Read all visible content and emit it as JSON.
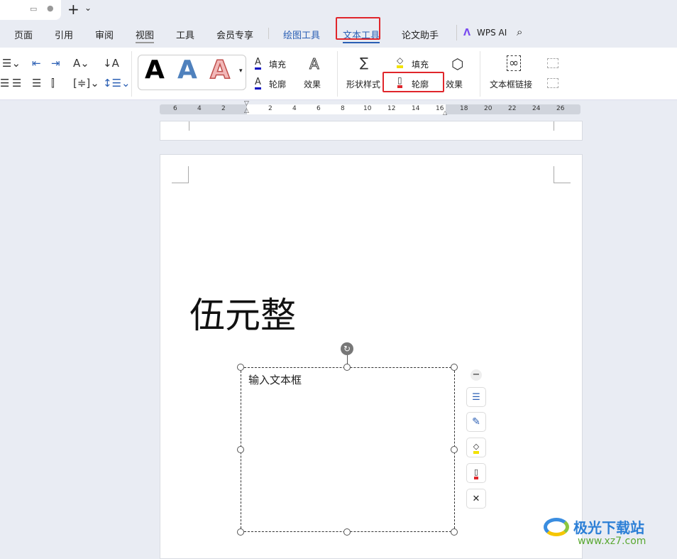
{
  "tabbar": {
    "new_tab": "+",
    "dropdown": "⌄"
  },
  "menu": {
    "items": [
      "页面",
      "引用",
      "审阅",
      "视图",
      "工具",
      "会员专享",
      "绘图工具",
      "文本工具",
      "论文助手"
    ],
    "wps_ai": "WPS AI"
  },
  "ribbon": {
    "fill": "填充",
    "outline": "轮廓",
    "effect": "效果",
    "shape_style": "形状样式",
    "fill2": "填充",
    "outline2": "轮廓",
    "effect2": "效果",
    "textbox_link": "文本框链接",
    "style_samples": [
      "A",
      "A",
      "A"
    ]
  },
  "ruler": {
    "ticks": [
      "6",
      "4",
      "2",
      "2",
      "4",
      "6",
      "8",
      "10",
      "12",
      "14",
      "16",
      "18",
      "20",
      "22",
      "24",
      "26"
    ]
  },
  "document": {
    "heading": "伍元整",
    "textbox_text": "输入文本框"
  },
  "watermark": {
    "name": "极光下载站",
    "url": "www.xz7.com"
  },
  "colors": {
    "accent": "#2b5fb4",
    "highlight": "#e0262b"
  }
}
